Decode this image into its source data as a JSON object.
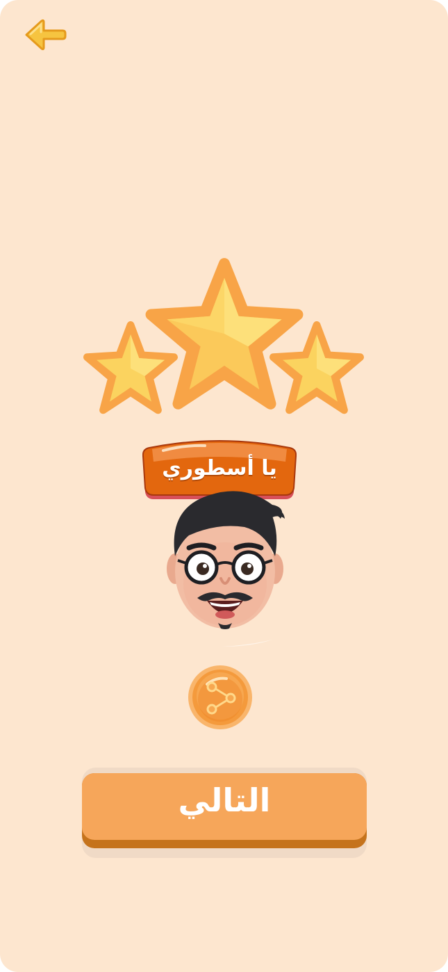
{
  "screen": {
    "background_color": "#fde6cf"
  },
  "header": {
    "back_icon": "arrow-left-icon"
  },
  "result": {
    "stars_total": 3,
    "stars_earned": 3,
    "star_color": "#fbd25a",
    "star_outline_color": "#f6a648"
  },
  "badge": {
    "label": "يا أسطوري",
    "color": "#e3670e"
  },
  "avatar": {
    "icon": "memoji-avatar-icon"
  },
  "share": {
    "icon": "share-icon",
    "color": "#f39b3f"
  },
  "next_button": {
    "label": "التالي",
    "color": "#f6a65a",
    "shadow_color": "#c5731c"
  }
}
